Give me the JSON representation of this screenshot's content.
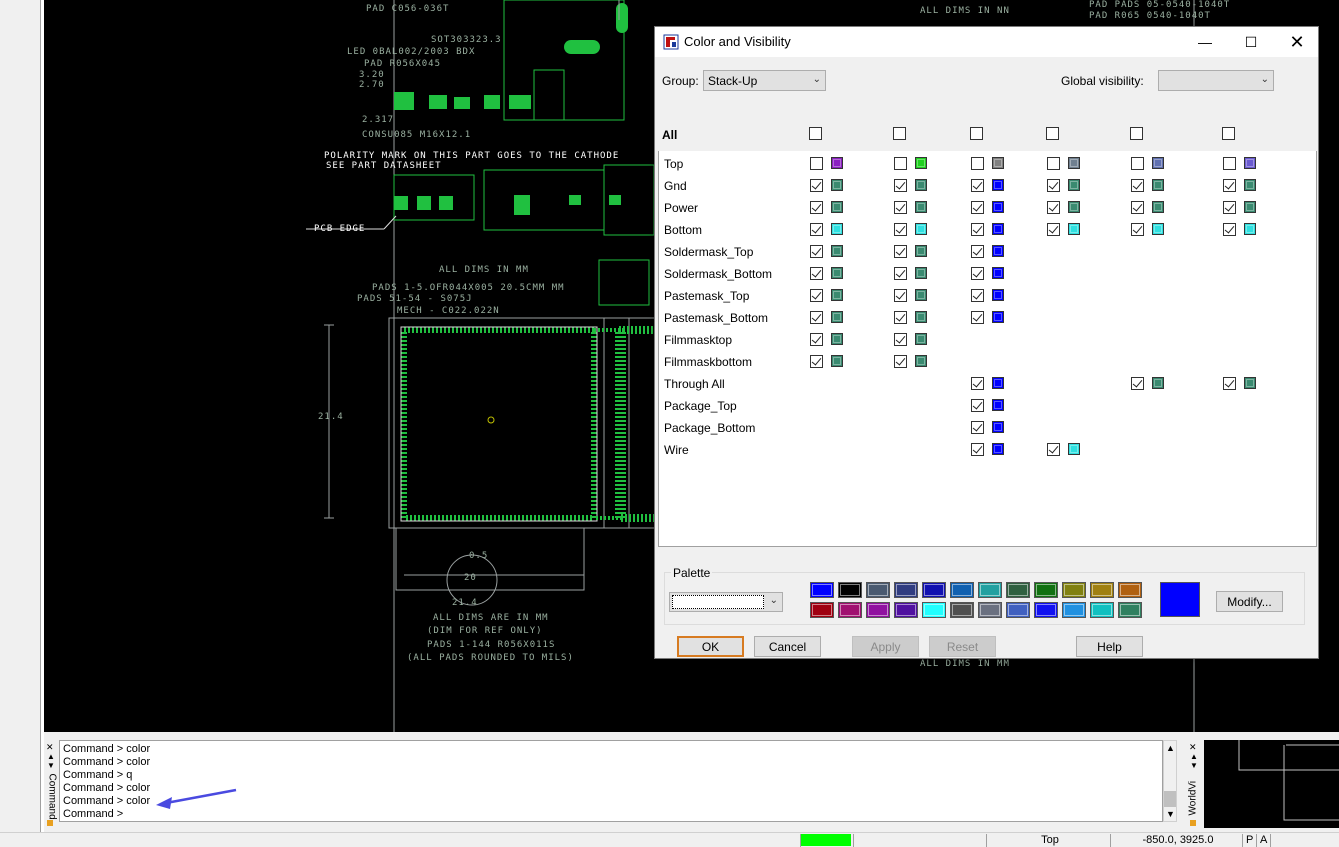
{
  "dialog": {
    "title": "Color and Visibility",
    "group_label": "Group:",
    "group_value": "Stack-Up",
    "global_visibility_label": "Global visibility:",
    "global_visibility_value": "",
    "all_label": "All",
    "layers": [
      {
        "name": "Top"
      },
      {
        "name": "Gnd"
      },
      {
        "name": "Power"
      },
      {
        "name": "Bottom"
      },
      {
        "name": "Soldermask_Top"
      },
      {
        "name": "Soldermask_Bottom"
      },
      {
        "name": "Pastemask_Top"
      },
      {
        "name": "Pastemask_Bottom"
      },
      {
        "name": "Filmmasktop"
      },
      {
        "name": "Filmmaskbottom"
      },
      {
        "name": "Through All"
      },
      {
        "name": "Package_Top"
      },
      {
        "name": "Package_Bottom"
      },
      {
        "name": "Wire"
      }
    ],
    "cells": [
      [
        [
          "off",
          "#8a20c0"
        ],
        [
          "off",
          "#20d020"
        ],
        [
          "off",
          "#808080"
        ],
        [
          "off",
          "#708090"
        ],
        [
          "off",
          "#6070b0"
        ],
        [
          "off",
          "#6a5ad0"
        ]
      ],
      [
        [
          "on",
          "#3a8a70"
        ],
        [
          "on",
          "#3a8a70"
        ],
        [
          "on",
          "#0000ff"
        ],
        [
          "on",
          "#3a8a70"
        ],
        [
          "on",
          "#3a8a70"
        ],
        [
          "on",
          "#3a8a70"
        ]
      ],
      [
        [
          "on",
          "#3a8a70"
        ],
        [
          "on",
          "#3a8a70"
        ],
        [
          "on",
          "#0000ff"
        ],
        [
          "on",
          "#3a8a70"
        ],
        [
          "on",
          "#3a8a70"
        ],
        [
          "on",
          "#3a8a70"
        ]
      ],
      [
        [
          "on",
          "#30e0e0"
        ],
        [
          "on",
          "#30e0e0"
        ],
        [
          "on",
          "#0000ff"
        ],
        [
          "on",
          "#30e0e0"
        ],
        [
          "on",
          "#30e0e0"
        ],
        [
          "on",
          "#30e0e0"
        ]
      ],
      [
        [
          "on",
          "#3a8a70"
        ],
        [
          "on",
          "#3a8a70"
        ],
        [
          "on",
          "#0000ff"
        ],
        null,
        null,
        null
      ],
      [
        [
          "on",
          "#3a8a70"
        ],
        [
          "on",
          "#3a8a70"
        ],
        [
          "on",
          "#0000ff"
        ],
        null,
        null,
        null
      ],
      [
        [
          "on",
          "#3a8a70"
        ],
        [
          "on",
          "#3a8a70"
        ],
        [
          "on",
          "#0000ff"
        ],
        null,
        null,
        null
      ],
      [
        [
          "on",
          "#3a8a70"
        ],
        [
          "on",
          "#3a8a70"
        ],
        [
          "on",
          "#0000ff"
        ],
        null,
        null,
        null
      ],
      [
        [
          "on",
          "#3a8a70"
        ],
        [
          "on",
          "#3a8a70"
        ],
        null,
        null,
        null,
        null
      ],
      [
        [
          "on",
          "#3a8a70"
        ],
        [
          "on",
          "#3a8a70"
        ],
        null,
        null,
        null,
        null
      ],
      [
        null,
        null,
        [
          "on",
          "#0000ff"
        ],
        null,
        [
          "on",
          "#3a8a70"
        ],
        [
          "on",
          "#3a8a70"
        ]
      ],
      [
        null,
        null,
        [
          "on",
          "#0000ff"
        ],
        null,
        null,
        null
      ],
      [
        null,
        null,
        [
          "on",
          "#0000ff"
        ],
        null,
        null,
        null
      ],
      [
        null,
        null,
        [
          "on",
          "#0000ff"
        ],
        [
          "on",
          "#30e0e0"
        ],
        null,
        null
      ]
    ],
    "palette_label": "Palette",
    "palette_colors_row1": [
      "#0000ff",
      "#000000",
      "#4a5a70",
      "#303c80",
      "#1010b0",
      "#1060b0",
      "#20a0a0",
      "#306040",
      "#107010",
      "#808010",
      "#a08010",
      "#b06010"
    ],
    "palette_colors_row2": [
      "#a00010",
      "#a01070",
      "#9010a0",
      "#5010a0",
      "#20ffff",
      "#505050",
      "#6a7080",
      "#4060c0",
      "#1010f0",
      "#2090e0",
      "#10c0c0",
      "#308060"
    ],
    "selected_color": "#0000ff",
    "modify_label": "Modify...",
    "ok_label": "OK",
    "cancel_label": "Cancel",
    "apply_label": "Apply",
    "reset_label": "Reset",
    "help_label": "Help"
  },
  "canvas": {
    "texts": [
      "PAD C056-036T",
      "SOT303323.3",
      "LED 0BAL002/2003 BDX",
      "PAD R056X045",
      "3.20",
      "2.70",
      "2.317",
      "CONSU085 M16X12.1",
      "POLARITY MARK ON THIS PART GOES TO THE CATHODE",
      "SEE PART DATASHEET",
      "PCB EDGE",
      "PADS 1-5.OFR044X005 20.5CMM MM",
      "PADS 51-54 - S075J",
      "MECH - C022.022N",
      "21.4",
      "0.5",
      "20",
      "21.4",
      "ALL DIMS ARE IN MM",
      "(DIM FOR REF ONLY)",
      "PADS 1-144 R056X011S",
      "(ALL PADS ROUNDED TO MILS)",
      "ALL DIMS IN MM",
      "PAD PADS 05-0540-1040T",
      "PAD R065 0540-1040T",
      "ALL DIMS IN NN",
      "ALL DIMS IN MM"
    ]
  },
  "command": {
    "side_label": "Command",
    "lines": [
      "Command > color",
      "Command > color",
      "Command > q",
      "Command > color",
      "Command > color",
      "Command >"
    ]
  },
  "world_view": {
    "side_label": "WorldVi"
  },
  "status": {
    "active_color": "#00ff00",
    "layer": "Top",
    "coords": "-850.0, 3925.0",
    "p": "P",
    "a": "A"
  }
}
